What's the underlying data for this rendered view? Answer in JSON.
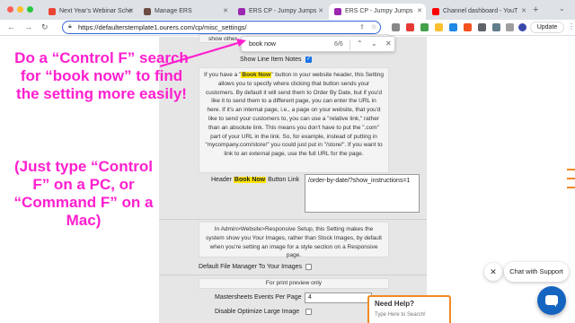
{
  "tabs": [
    {
      "label": "Next Year's Webinar Sche",
      "fav_color": "#ea4335"
    },
    {
      "label": "Manage ERS",
      "fav_color": "#6d4c41"
    },
    {
      "label": "ERS CP - Jumpy Jumps",
      "fav_color": "#9c27b0"
    },
    {
      "label": "ERS CP - Jumpy Jumps",
      "fav_color": "#9c27b0"
    },
    {
      "label": "Channel dashboard - YouT",
      "fav_color": "#ff0000"
    }
  ],
  "toolbar": {
    "url": "https://defaulterstemplate1.ourers.com/cp/misc_settings/",
    "update_label": "Update"
  },
  "find": {
    "query": "book now",
    "count": "6/6"
  },
  "settings": {
    "partial_text": "show other",
    "show_line_item_notes": "Show Line Item Notes",
    "book_now_help": {
      "pre": "If you have a \"",
      "hl": "Book Now",
      "post": "\" button in your website header, this Setting allows you to specify where clicking that button sends your customers. By default it will send them to Order By Date, but if you'd like it to send them to a different page, you can enter the URL in here. If it's an internal page, i.e., a page on your website, that you'd like to send your customers to, you can use a \"relative link,\" rather than an absolute link. This means you don't have to put the \".com\" part of your URL in the link. So, for example, instead of putting in \"mycompany.com/store/\" you could just put in \"/store/\". If you want to link to an external page, use the full URL for the page."
    },
    "header_link_label": {
      "pre": "Header ",
      "hl": "Book Now",
      "post": " Button Link"
    },
    "header_link_value": "/order-by-date/?show_instructions=1",
    "responsive_help": "In Admin>Website>Responsive Setup, this Setting makes the system show you Your Images, rather than Stock Images, by default when you're setting an image for a style section on a Responsive page.",
    "default_file_manager": "Default File Manager To Your Images",
    "print_preview": "For print preview only",
    "mastersheets_label": "Mastersheets Events Per Page",
    "mastersheets_value": "4",
    "disable_optimize": "Disable Optimize Large Image"
  },
  "annotation": {
    "main": "Do a “Control F” search for “book now” to find the setting more easily!",
    "sub": "(Just type “Control F” on a PC, or “Command F” on a Mac)"
  },
  "widgets": {
    "need_help_title": "Need Help?",
    "need_help_sub": "Type Here to Search!",
    "chat_label": "Chat with Support"
  },
  "colors": {
    "annotation": "#ff1fcf",
    "highlight": "#ffe600",
    "accent": "#1565c0",
    "orange": "#f08a24"
  }
}
